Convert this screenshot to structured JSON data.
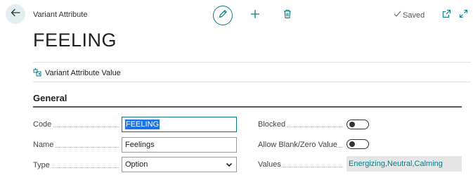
{
  "header": {
    "caption": "Variant Attribute",
    "saved_label": "Saved",
    "title": "FEELING"
  },
  "actions": {
    "variant_attribute_value": "Variant Attribute Value"
  },
  "section": {
    "title": "General"
  },
  "fields": {
    "code": {
      "label": "Code",
      "value": "FEELING"
    },
    "name": {
      "label": "Name",
      "value": "Feelings"
    },
    "type": {
      "label": "Type",
      "value": "Option"
    },
    "blocked": {
      "label": "Blocked",
      "value": false
    },
    "allow_blank": {
      "label": "Allow Blank/Zero Value",
      "value": false
    },
    "values": {
      "label": "Values",
      "value": "Energizing,Neutral,Calming"
    }
  },
  "icons": {
    "back": "back-arrow-icon",
    "edit": "pencil-icon",
    "new": "plus-icon",
    "delete": "trash-icon",
    "saved": "checkmark-icon",
    "open_new_window": "open-in-new-window-icon",
    "expand": "expand-icon",
    "action": "attribute-value-icon"
  },
  "colors": {
    "accent": "#0a7b83",
    "back_button_bg": "#e3eef0",
    "selection": "#1a73e8"
  }
}
